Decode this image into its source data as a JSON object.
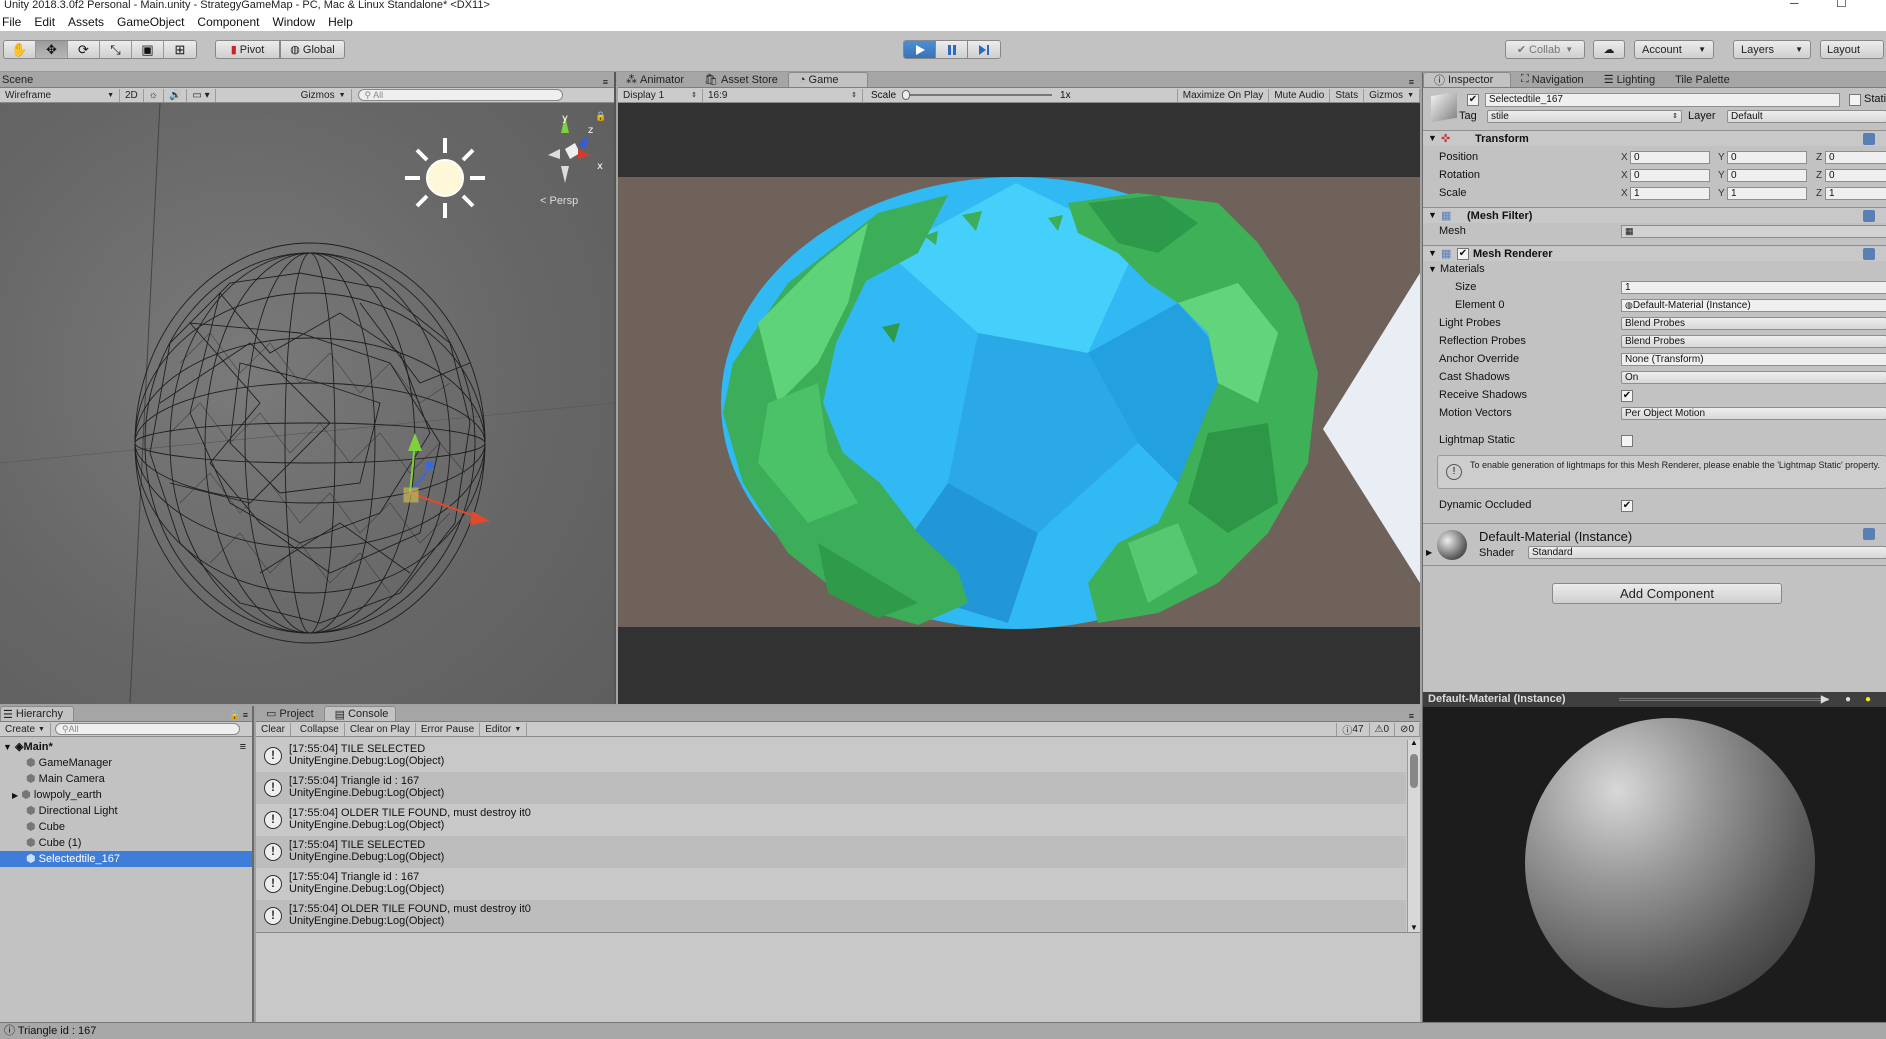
{
  "window": {
    "title": "Unity 2018.3.0f2 Personal - Main.unity - StrategyGameMap - PC, Mac & Linux Standalone* <DX11>"
  },
  "menu": [
    "File",
    "Edit",
    "Assets",
    "GameObject",
    "Component",
    "Window",
    "Help"
  ],
  "toolbar": {
    "pivot": "Pivot",
    "global": "Global",
    "collab": "Collab",
    "account": "Account",
    "layers": "Layers",
    "layout": "Layout"
  },
  "scene": {
    "tab": "Scene",
    "render_mode": "Wireframe",
    "mode_2d": "2D",
    "gizmos": "Gizmos",
    "search_placeholder": "All",
    "persp": "< Persp",
    "gizmo_y": "y",
    "gizmo_x": "x",
    "gizmo_z": "z"
  },
  "game": {
    "tabs": [
      "Animator",
      "Asset Store",
      "Game"
    ],
    "display": "Display 1",
    "aspect": "16:9",
    "scale_label": "Scale",
    "scale_value": "1x",
    "buttons": [
      "Maximize On Play",
      "Mute Audio",
      "Stats",
      "Gizmos"
    ]
  },
  "inspector": {
    "tabs": [
      "Inspector",
      "Navigation",
      "Lighting",
      "Tile Palette"
    ],
    "object_name": "Selectedtile_167",
    "static_label": "Stati",
    "tag_label": "Tag",
    "tag_value": "stile",
    "layer_label": "Layer",
    "layer_value": "Default",
    "transform": {
      "title": "Transform",
      "position": {
        "label": "Position",
        "x": "0",
        "y": "0",
        "z": "0"
      },
      "rotation": {
        "label": "Rotation",
        "x": "0",
        "y": "0",
        "z": "0"
      },
      "scale": {
        "label": "Scale",
        "x": "1",
        "y": "1",
        "z": "1"
      }
    },
    "mesh_filter": {
      "title": "(Mesh Filter)",
      "mesh_label": "Mesh"
    },
    "mesh_renderer": {
      "title": "Mesh Renderer",
      "materials_label": "Materials",
      "size_label": "Size",
      "size_value": "1",
      "element0_label": "Element 0",
      "element0_value": "Default-Material (Instance)",
      "light_probes_label": "Light Probes",
      "light_probes_value": "Blend Probes",
      "reflection_probes_label": "Reflection Probes",
      "reflection_probes_value": "Blend Probes",
      "anchor_override_label": "Anchor Override",
      "anchor_override_value": "None (Transform)",
      "cast_shadows_label": "Cast Shadows",
      "cast_shadows_value": "On",
      "receive_shadows_label": "Receive Shadows",
      "motion_vectors_label": "Motion Vectors",
      "motion_vectors_value": "Per Object Motion",
      "lightmap_static_label": "Lightmap Static",
      "lightmap_info": "To enable generation of lightmaps for this Mesh Renderer, please enable the 'Lightmap Static' property.",
      "dynamic_occluded_label": "Dynamic Occluded"
    },
    "material": {
      "name": "Default-Material (Instance)",
      "shader_label": "Shader",
      "shader_value": "Standard"
    },
    "add_component": "Add Component"
  },
  "preview": {
    "title": "Default-Material (Instance)"
  },
  "hierarchy": {
    "tab": "Hierarchy",
    "create": "Create",
    "search_placeholder": "All",
    "scene_name": "Main*",
    "items": [
      "GameManager",
      "Main Camera",
      "lowpoly_earth",
      "Directional Light",
      "Cube",
      "Cube (1)",
      "Selectedtile_167"
    ]
  },
  "console": {
    "tabs": [
      "Project",
      "Console"
    ],
    "buttons": [
      "Clear",
      "Collapse",
      "Clear on Play",
      "Error Pause",
      "Editor"
    ],
    "counts": {
      "log": "47",
      "warn": "0",
      "error": "0"
    },
    "entries": [
      {
        "line1": "[17:55:04] TILE SELECTED",
        "line2": "UnityEngine.Debug:Log(Object)"
      },
      {
        "line1": "[17:55:04] Triangle id : 167",
        "line2": "UnityEngine.Debug:Log(Object)"
      },
      {
        "line1": "[17:55:04] OLDER TILE FOUND, must destroy it0",
        "line2": "UnityEngine.Debug:Log(Object)"
      },
      {
        "line1": "[17:55:04] TILE SELECTED",
        "line2": "UnityEngine.Debug:Log(Object)"
      },
      {
        "line1": "[17:55:04] Triangle id : 167",
        "line2": "UnityEngine.Debug:Log(Object)"
      },
      {
        "line1": "[17:55:04] OLDER TILE FOUND, must destroy it0",
        "line2": "UnityEngine.Debug:Log(Object)"
      }
    ]
  },
  "status": {
    "text": "Triangle id : 167"
  },
  "colors": {
    "accent": "#3e7dd8",
    "play_active": "#3872b8",
    "ocean": "#2fb8f0",
    "land": "#3dab5a"
  }
}
